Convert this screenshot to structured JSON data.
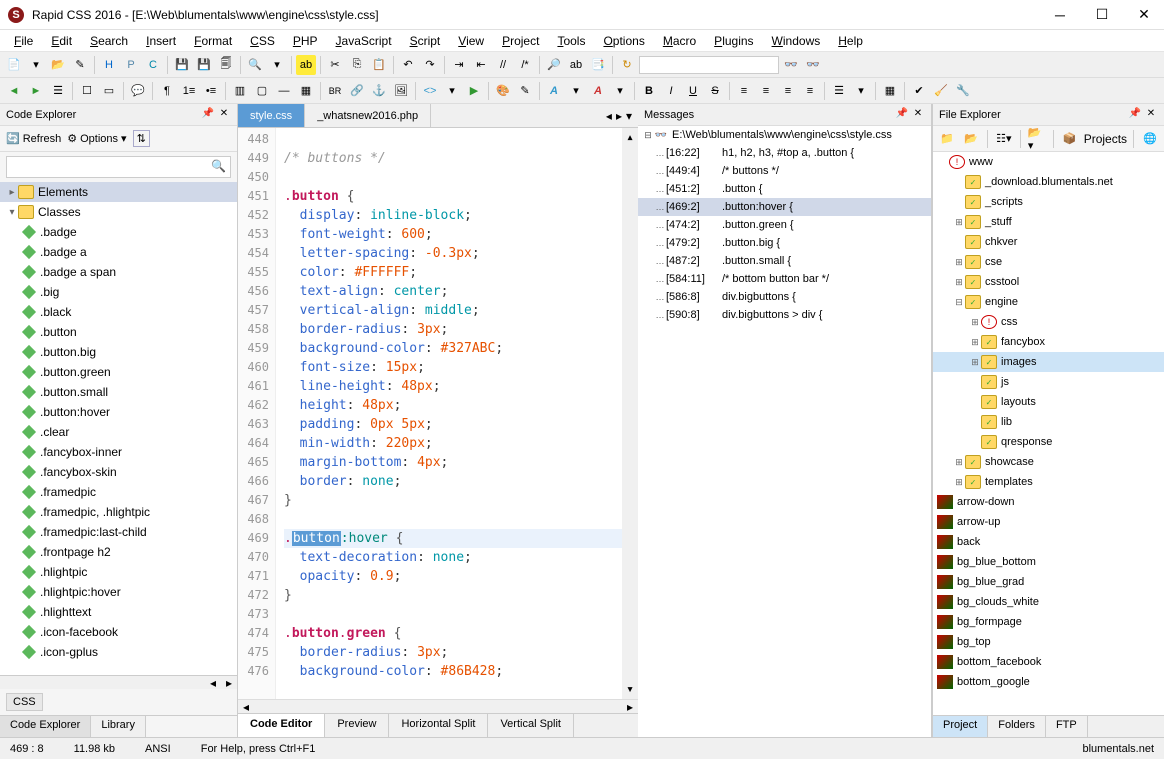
{
  "app": {
    "title": "Rapid CSS 2016 - [E:\\Web\\blumentals\\www\\engine\\css\\style.css]",
    "icon_letter": "S"
  },
  "menu": [
    "File",
    "Edit",
    "Search",
    "Insert",
    "Format",
    "CSS",
    "PHP",
    "JavaScript",
    "Script",
    "View",
    "Project",
    "Tools",
    "Options",
    "Macro",
    "Plugins",
    "Windows",
    "Help"
  ],
  "left": {
    "title": "Code Explorer",
    "refresh": "Refresh",
    "options": "Options",
    "search_placeholder": "",
    "elements_label": "Elements",
    "classes_label": "Classes",
    "classes": [
      ".badge",
      ".badge a",
      ".badge a span",
      ".big",
      ".black",
      ".button",
      ".button.big",
      ".button.green",
      ".button.small",
      ".button:hover",
      ".clear",
      ".fancybox-inner",
      ".fancybox-skin",
      ".framedpic",
      ".framedpic, .hlightpic",
      ".framedpic:last-child",
      ".frontpage h2",
      ".hlightpic",
      ".hlightpic:hover",
      ".hlighttext",
      ".icon-facebook",
      ".icon-gplus"
    ],
    "css_badge": "CSS",
    "tabs": [
      "Code Explorer",
      "Library"
    ]
  },
  "editor": {
    "tabs": [
      "style.css",
      "_whatsnew2016.php"
    ],
    "active_tab": 0,
    "lines": [
      {
        "n": 448,
        "tokens": []
      },
      {
        "n": 449,
        "tokens": [
          [
            "comment",
            "/* buttons */"
          ]
        ]
      },
      {
        "n": 450,
        "tokens": []
      },
      {
        "n": 451,
        "tokens": [
          [
            "seldot",
            "."
          ],
          [
            "selname",
            "button"
          ],
          [
            "space",
            " "
          ],
          [
            "brace",
            "{"
          ]
        ]
      },
      {
        "n": 452,
        "tokens": [
          [
            "indent",
            "  "
          ],
          [
            "prop",
            "display"
          ],
          [
            "plain",
            ": "
          ],
          [
            "value",
            "inline-block"
          ],
          [
            "plain",
            ";"
          ]
        ]
      },
      {
        "n": 453,
        "tokens": [
          [
            "indent",
            "  "
          ],
          [
            "prop",
            "font-weight"
          ],
          [
            "plain",
            ": "
          ],
          [
            "number",
            "600"
          ],
          [
            "plain",
            ";"
          ]
        ]
      },
      {
        "n": 454,
        "tokens": [
          [
            "indent",
            "  "
          ],
          [
            "prop",
            "letter-spacing"
          ],
          [
            "plain",
            ": "
          ],
          [
            "number",
            "-0.3px"
          ],
          [
            "plain",
            ";"
          ]
        ]
      },
      {
        "n": 455,
        "tokens": [
          [
            "indent",
            "  "
          ],
          [
            "prop",
            "color"
          ],
          [
            "plain",
            ": "
          ],
          [
            "hex",
            "#FFFFFF"
          ],
          [
            "plain",
            ";"
          ]
        ]
      },
      {
        "n": 456,
        "tokens": [
          [
            "indent",
            "  "
          ],
          [
            "prop",
            "text-align"
          ],
          [
            "plain",
            ": "
          ],
          [
            "value",
            "center"
          ],
          [
            "plain",
            ";"
          ]
        ]
      },
      {
        "n": 457,
        "tokens": [
          [
            "indent",
            "  "
          ],
          [
            "prop",
            "vertical-align"
          ],
          [
            "plain",
            ": "
          ],
          [
            "value",
            "middle"
          ],
          [
            "plain",
            ";"
          ]
        ]
      },
      {
        "n": 458,
        "tokens": [
          [
            "indent",
            "  "
          ],
          [
            "prop",
            "border-radius"
          ],
          [
            "plain",
            ": "
          ],
          [
            "number",
            "3px"
          ],
          [
            "plain",
            ";"
          ]
        ]
      },
      {
        "n": 459,
        "tokens": [
          [
            "indent",
            "  "
          ],
          [
            "prop",
            "background-color"
          ],
          [
            "plain",
            ": "
          ],
          [
            "hex",
            "#327ABC"
          ],
          [
            "plain",
            ";"
          ]
        ]
      },
      {
        "n": 460,
        "tokens": [
          [
            "indent",
            "  "
          ],
          [
            "prop",
            "font-size"
          ],
          [
            "plain",
            ": "
          ],
          [
            "number",
            "15px"
          ],
          [
            "plain",
            ";"
          ]
        ]
      },
      {
        "n": 461,
        "tokens": [
          [
            "indent",
            "  "
          ],
          [
            "prop",
            "line-height"
          ],
          [
            "plain",
            ": "
          ],
          [
            "number",
            "48px"
          ],
          [
            "plain",
            ";"
          ]
        ]
      },
      {
        "n": 462,
        "tokens": [
          [
            "indent",
            "  "
          ],
          [
            "prop",
            "height"
          ],
          [
            "plain",
            ": "
          ],
          [
            "number",
            "48px"
          ],
          [
            "plain",
            ";"
          ]
        ]
      },
      {
        "n": 463,
        "tokens": [
          [
            "indent",
            "  "
          ],
          [
            "prop",
            "padding"
          ],
          [
            "plain",
            ": "
          ],
          [
            "number",
            "0px 5px"
          ],
          [
            "plain",
            ";"
          ]
        ]
      },
      {
        "n": 464,
        "tokens": [
          [
            "indent",
            "  "
          ],
          [
            "prop",
            "min-width"
          ],
          [
            "plain",
            ": "
          ],
          [
            "number",
            "220px"
          ],
          [
            "plain",
            ";"
          ]
        ]
      },
      {
        "n": 465,
        "tokens": [
          [
            "indent",
            "  "
          ],
          [
            "prop",
            "margin-bottom"
          ],
          [
            "plain",
            ": "
          ],
          [
            "number",
            "4px"
          ],
          [
            "plain",
            ";"
          ]
        ]
      },
      {
        "n": 466,
        "tokens": [
          [
            "indent",
            "  "
          ],
          [
            "prop",
            "border"
          ],
          [
            "plain",
            ": "
          ],
          [
            "value",
            "none"
          ],
          [
            "plain",
            ";"
          ]
        ]
      },
      {
        "n": 467,
        "tokens": [
          [
            "brace",
            "}"
          ]
        ]
      },
      {
        "n": 468,
        "tokens": []
      },
      {
        "n": 469,
        "current": true,
        "tokens": [
          [
            "seldot",
            "."
          ],
          [
            "selhl",
            "button"
          ],
          [
            "pseudo",
            ":hover"
          ],
          [
            "space",
            " "
          ],
          [
            "brace",
            "{"
          ]
        ]
      },
      {
        "n": 470,
        "tokens": [
          [
            "indent",
            "  "
          ],
          [
            "prop",
            "text-decoration"
          ],
          [
            "plain",
            ": "
          ],
          [
            "value",
            "none"
          ],
          [
            "plain",
            ";"
          ]
        ]
      },
      {
        "n": 471,
        "tokens": [
          [
            "indent",
            "  "
          ],
          [
            "prop",
            "opacity"
          ],
          [
            "plain",
            ": "
          ],
          [
            "number",
            "0.9"
          ],
          [
            "plain",
            ";"
          ]
        ]
      },
      {
        "n": 472,
        "tokens": [
          [
            "brace",
            "}"
          ]
        ]
      },
      {
        "n": 473,
        "tokens": []
      },
      {
        "n": 474,
        "tokens": [
          [
            "seldot",
            "."
          ],
          [
            "selname",
            "button"
          ],
          [
            "seldot",
            "."
          ],
          [
            "selname",
            "green"
          ],
          [
            "space",
            " "
          ],
          [
            "brace",
            "{"
          ]
        ]
      },
      {
        "n": 475,
        "tokens": [
          [
            "indent",
            "  "
          ],
          [
            "prop",
            "border-radius"
          ],
          [
            "plain",
            ": "
          ],
          [
            "number",
            "3px"
          ],
          [
            "plain",
            ";"
          ]
        ]
      },
      {
        "n": 476,
        "tokens": [
          [
            "indent",
            "  "
          ],
          [
            "prop",
            "background-color"
          ],
          [
            "plain",
            ": "
          ],
          [
            "hex",
            "#86B428"
          ],
          [
            "plain",
            ";"
          ]
        ]
      }
    ],
    "footer_tabs": [
      "Code Editor",
      "Preview",
      "Horizontal Split",
      "Vertical Split"
    ]
  },
  "messages": {
    "title": "Messages",
    "root": "E:\\Web\\blumentals\\www\\engine\\css\\style.css",
    "items": [
      {
        "loc": "[16:22]",
        "txt": "h1, h2, h3, #top a, .button {"
      },
      {
        "loc": "[449:4]",
        "txt": "/* buttons */"
      },
      {
        "loc": "[451:2]",
        "txt": ".button {"
      },
      {
        "loc": "[469:2]",
        "txt": ".button:hover {",
        "selected": true
      },
      {
        "loc": "[474:2]",
        "txt": ".button.green {"
      },
      {
        "loc": "[479:2]",
        "txt": ".button.big {"
      },
      {
        "loc": "[487:2]",
        "txt": ".button.small {"
      },
      {
        "loc": "[584:11]",
        "txt": "/* bottom button bar */"
      },
      {
        "loc": "[586:8]",
        "txt": "div.bigbuttons {"
      },
      {
        "loc": "[590:8]",
        "txt": "div.bigbuttons > div {"
      }
    ]
  },
  "file_explorer": {
    "title": "File Explorer",
    "projects_label": "Projects",
    "tree": [
      {
        "d": 0,
        "exp": "",
        "ico": "warn",
        "label": "www"
      },
      {
        "d": 1,
        "exp": "",
        "ico": "folder-ok",
        "label": "_download.blumentals.net"
      },
      {
        "d": 1,
        "exp": "",
        "ico": "folder-ok",
        "label": "_scripts"
      },
      {
        "d": 1,
        "exp": "+",
        "ico": "folder-ok",
        "label": "_stuff"
      },
      {
        "d": 1,
        "exp": "",
        "ico": "folder-ok",
        "label": "chkver"
      },
      {
        "d": 1,
        "exp": "+",
        "ico": "folder-ok",
        "label": "cse"
      },
      {
        "d": 1,
        "exp": "+",
        "ico": "folder-ok",
        "label": "csstool"
      },
      {
        "d": 1,
        "exp": "-",
        "ico": "folder-ok",
        "label": "engine"
      },
      {
        "d": 2,
        "exp": "+",
        "ico": "warn",
        "label": "css"
      },
      {
        "d": 2,
        "exp": "+",
        "ico": "folder-ok",
        "label": "fancybox"
      },
      {
        "d": 2,
        "exp": "+",
        "ico": "folder-ok",
        "label": "images",
        "selected": true
      },
      {
        "d": 2,
        "exp": "",
        "ico": "folder-ok",
        "label": "js"
      },
      {
        "d": 2,
        "exp": "",
        "ico": "folder-ok",
        "label": "layouts"
      },
      {
        "d": 2,
        "exp": "",
        "ico": "folder-ok",
        "label": "lib"
      },
      {
        "d": 2,
        "exp": "",
        "ico": "folder-ok",
        "label": "qresponse"
      },
      {
        "d": 1,
        "exp": "+",
        "ico": "folder-ok",
        "label": "showcase"
      },
      {
        "d": 1,
        "exp": "+",
        "ico": "folder-ok",
        "label": "templates"
      }
    ],
    "files": [
      "arrow-down",
      "arrow-up",
      "back",
      "bg_blue_bottom",
      "bg_blue_grad",
      "bg_clouds_white",
      "bg_formpage",
      "bg_top",
      "bottom_facebook",
      "bottom_google"
    ],
    "footer_tabs": [
      "Project",
      "Folders",
      "FTP"
    ]
  },
  "status": {
    "pos": "469 : 8",
    "size": "11.98 kb",
    "encoding": "ANSI",
    "help": "For Help, press Ctrl+F1",
    "project": "blumentals.net"
  }
}
